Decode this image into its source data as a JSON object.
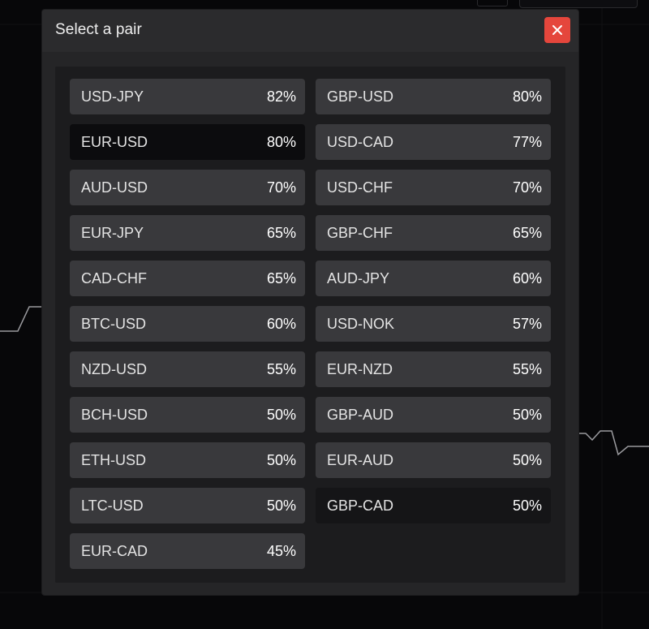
{
  "modal": {
    "title": "Select a pair",
    "close_icon": "close-icon",
    "accent_color": "#e5463c"
  },
  "pairs": [
    {
      "name": "USD-JPY",
      "pct": "82%"
    },
    {
      "name": "GBP-USD",
      "pct": "80%"
    },
    {
      "name": "EUR-USD",
      "pct": "80%",
      "state": "selected"
    },
    {
      "name": "USD-CAD",
      "pct": "77%"
    },
    {
      "name": "AUD-USD",
      "pct": "70%"
    },
    {
      "name": "USD-CHF",
      "pct": "70%"
    },
    {
      "name": "EUR-JPY",
      "pct": "65%"
    },
    {
      "name": "GBP-CHF",
      "pct": "65%"
    },
    {
      "name": "CAD-CHF",
      "pct": "65%"
    },
    {
      "name": "AUD-JPY",
      "pct": "60%"
    },
    {
      "name": "BTC-USD",
      "pct": "60%"
    },
    {
      "name": "USD-NOK",
      "pct": "57%"
    },
    {
      "name": "NZD-USD",
      "pct": "55%"
    },
    {
      "name": "EUR-NZD",
      "pct": "55%"
    },
    {
      "name": "BCH-USD",
      "pct": "50%"
    },
    {
      "name": "GBP-AUD",
      "pct": "50%"
    },
    {
      "name": "ETH-USD",
      "pct": "50%"
    },
    {
      "name": "EUR-AUD",
      "pct": "50%"
    },
    {
      "name": "LTC-USD",
      "pct": "50%"
    },
    {
      "name": "GBP-CAD",
      "pct": "50%",
      "state": "hover"
    },
    {
      "name": "EUR-CAD",
      "pct": "45%"
    }
  ]
}
